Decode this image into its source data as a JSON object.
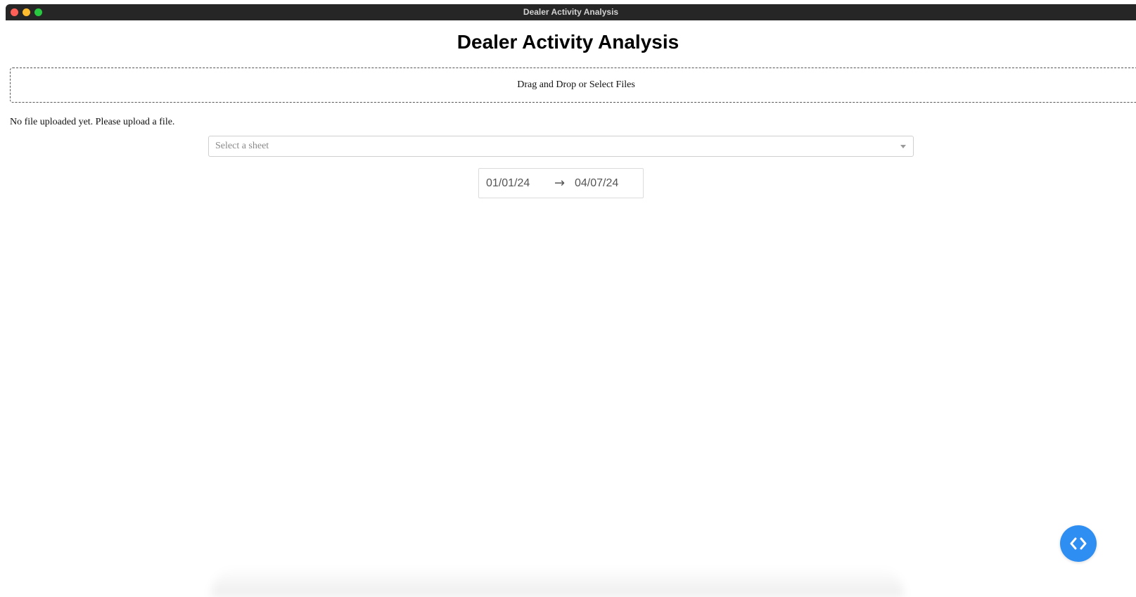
{
  "window": {
    "title": "Dealer Activity Analysis"
  },
  "page": {
    "title": "Dealer Activity Analysis"
  },
  "upload": {
    "prompt": "Drag and Drop or Select Files",
    "status": "No file uploaded yet. Please upload a file."
  },
  "sheet_select": {
    "placeholder": "Select a sheet"
  },
  "date_range": {
    "start": "01/01/24",
    "end": "04/07/24",
    "separator": "→"
  },
  "icons": {
    "code_toggle": "code-brackets-icon",
    "dropdown": "chevron-down-icon"
  },
  "colors": {
    "titlebar": "#262626",
    "fab": "#2f8ef2"
  }
}
